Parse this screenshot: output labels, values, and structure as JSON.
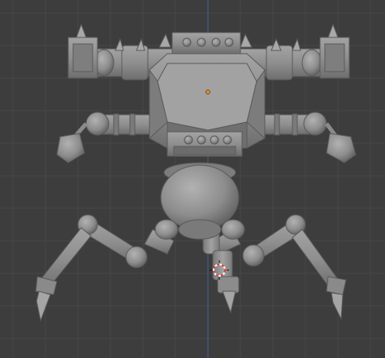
{
  "viewport": {
    "view": "front-orthographic",
    "background_color": "#3d3d3d",
    "grid_color": "#464646",
    "grid_major_color": "#4c4c4c",
    "axis_z_color": "#3f60a8",
    "object_color": "#8f8f8f",
    "object_shadow_color": "#6f6f6f",
    "object_highlight_color": "#a9a9a9",
    "origin_dot_color": "#f08a24",
    "cursor_color_a": "#e23b3b",
    "cursor_color_b": "#ffffff",
    "object": "robot-walker-model",
    "origin_icon": "object-origin-dot",
    "cursor_icon": "3d-cursor-icon"
  }
}
